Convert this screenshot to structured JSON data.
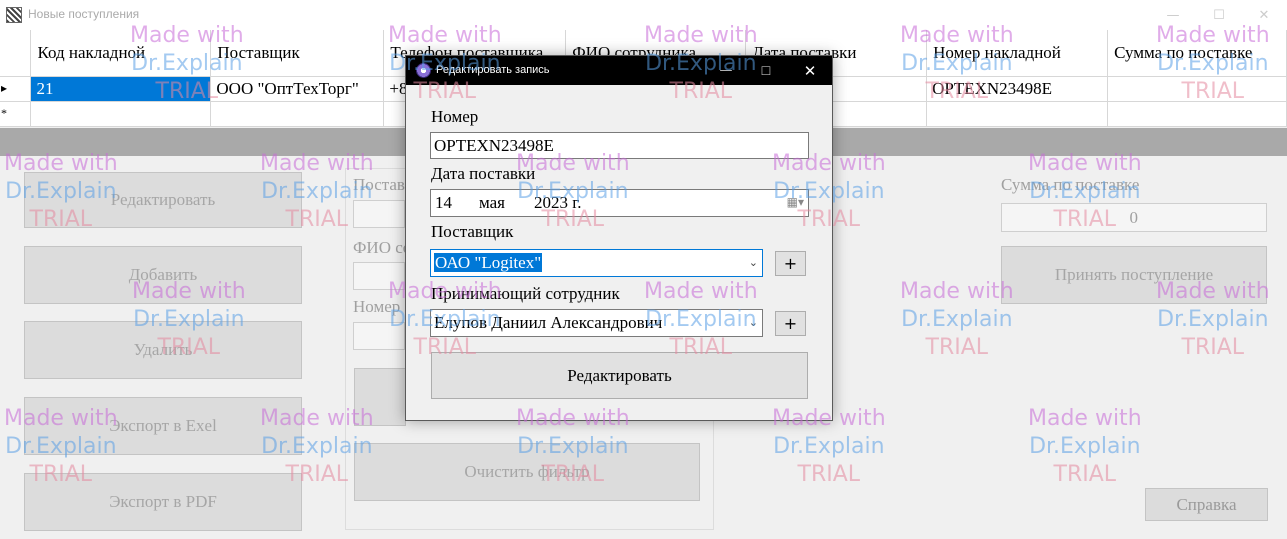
{
  "window": {
    "title": "Новые поступления",
    "minimize_icon": "minimize-icon",
    "maximize_icon": "maximize-icon",
    "close_icon": "close-icon",
    "min_glyph": "—",
    "max_glyph": "☐",
    "close_glyph": "✕"
  },
  "grid": {
    "columns": [
      "Код накладной",
      "Поставщик",
      "Телефон поставщика",
      "ФИО сотрудника",
      "Дата поставки",
      "Номер накладной",
      "Сумма по поставке"
    ],
    "rows": [
      {
        "marker": "▸",
        "cells": [
          "21",
          "ООО \"ОптТехТорг\"",
          "+8",
          "",
          "",
          "OPTEXN23498E",
          ""
        ]
      },
      {
        "marker": "*",
        "cells": [
          "",
          "",
          "",
          "",
          "",
          "",
          ""
        ]
      }
    ]
  },
  "buttons": {
    "edit": "Редактировать",
    "add": "Добавить",
    "delete": "Удалить",
    "export_excel": "Экспорт в Exel",
    "export_pdf": "Экспорт в PDF",
    "clear_filter": "Очистить фильтр",
    "accept": "Принять поступление",
    "help": "Справка"
  },
  "filter": {
    "supplier_label": "Поставщик",
    "employee_label": "ФИО сотрудника",
    "number_label": "Номер"
  },
  "summary": {
    "label": "Сумма по поставке",
    "value": "0"
  },
  "dialog": {
    "title": "Редактировать запись",
    "number_label": "Номер",
    "number_value": "OPTEXN23498E",
    "date_label": "Дата поставки",
    "date_day": "14",
    "date_month": "мая",
    "date_year": "2023 г.",
    "supplier_label": "Поставщик",
    "supplier_value": "ОАО \"Logitex\"",
    "employee_label": "Принимающий сотрудник",
    "employee_value": "Елупов Даниил Александрович",
    "plus": "+",
    "dropdown_glyph": "⌄",
    "calendar_glyph": "▦▾",
    "submit": "Редактировать"
  },
  "watermark": {
    "line1": "Made with",
    "line2": "Dr.Explain",
    "line3": "TRIAL"
  },
  "colors": {
    "selection": "#0078d7",
    "separator": "#a9a9a9",
    "dialog_titlebar": "#000000"
  }
}
